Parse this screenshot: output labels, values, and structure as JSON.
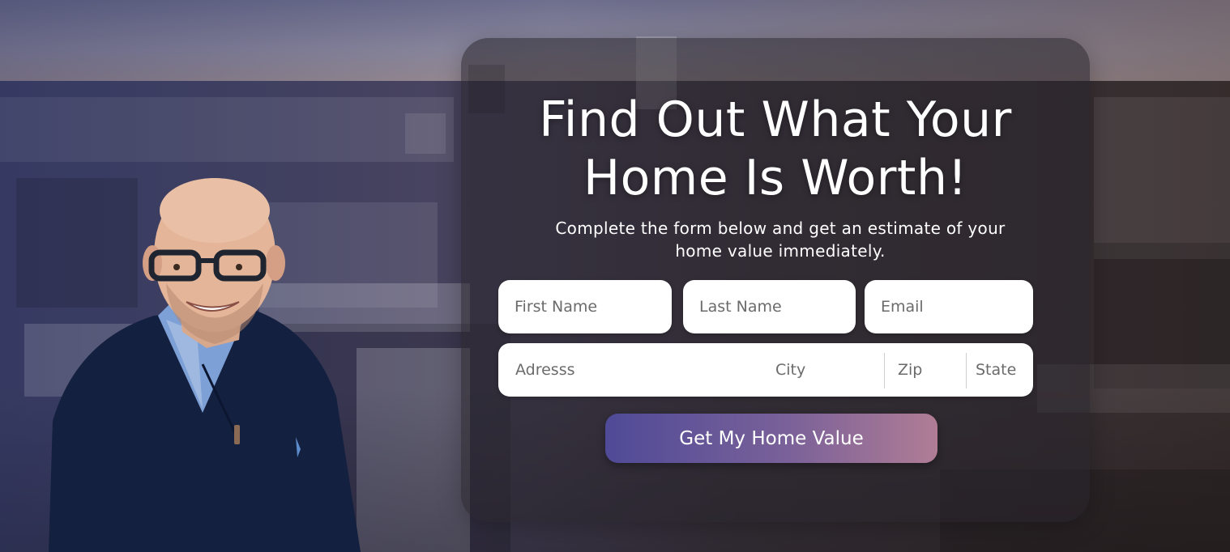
{
  "hero": {
    "headline_line1": "Find Out What Your",
    "headline_line2": "Home Is Worth!",
    "subtitle_line1": "Complete the form below and get an estimate of your",
    "subtitle_line2": "home value immediately."
  },
  "form": {
    "first_name": {
      "placeholder": "First Name",
      "value": ""
    },
    "last_name": {
      "placeholder": "Last Name",
      "value": ""
    },
    "email": {
      "placeholder": "Email",
      "value": ""
    },
    "address": {
      "placeholder": "Adresss",
      "value": ""
    },
    "city": {
      "placeholder": "City",
      "value": ""
    },
    "zip": {
      "placeholder": "Zip",
      "value": ""
    },
    "state": {
      "placeholder": "State",
      "value": ""
    },
    "submit_label": "Get My Home Value"
  },
  "colors": {
    "button_gradient_start": "#4f4a97",
    "button_gradient_end": "#b07d95",
    "panel_bg": "rgba(40,36,44,0.55)",
    "text": "#ffffff"
  }
}
